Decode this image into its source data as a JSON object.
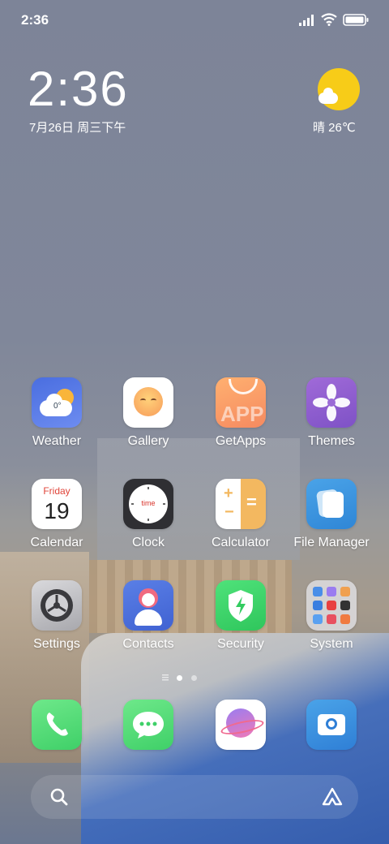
{
  "status_bar": {
    "time": "2:36"
  },
  "clock_widget": {
    "time": "2:36",
    "date": "7月26日 周三下午"
  },
  "weather_widget": {
    "text": "晴 26℃"
  },
  "weather_icon_badge": "0°",
  "calendar_icon": {
    "weekday": "Friday",
    "day": "19"
  },
  "clock_icon": {
    "text": "time"
  },
  "getapps_icon": {
    "text": "APP"
  },
  "apps_row1": [
    {
      "label": "Weather"
    },
    {
      "label": "Gallery"
    },
    {
      "label": "GetApps"
    },
    {
      "label": "Themes"
    }
  ],
  "apps_row2": [
    {
      "label": "Calendar"
    },
    {
      "label": "Clock"
    },
    {
      "label": "Calculator"
    },
    {
      "label": "File Manager"
    }
  ],
  "apps_row3": [
    {
      "label": "Settings"
    },
    {
      "label": "Contacts"
    },
    {
      "label": "Security"
    },
    {
      "label": "System"
    }
  ],
  "dock": [
    {
      "icon": "phone-icon"
    },
    {
      "icon": "messages-icon"
    },
    {
      "icon": "planet-browser-icon"
    },
    {
      "icon": "camera-icon"
    }
  ],
  "page_indicator": {
    "current": 1,
    "total": 2
  },
  "colors": {
    "accent_green": "#4cd964",
    "weather_sun": "#f7cc18",
    "security_green": "#3ddc68"
  }
}
